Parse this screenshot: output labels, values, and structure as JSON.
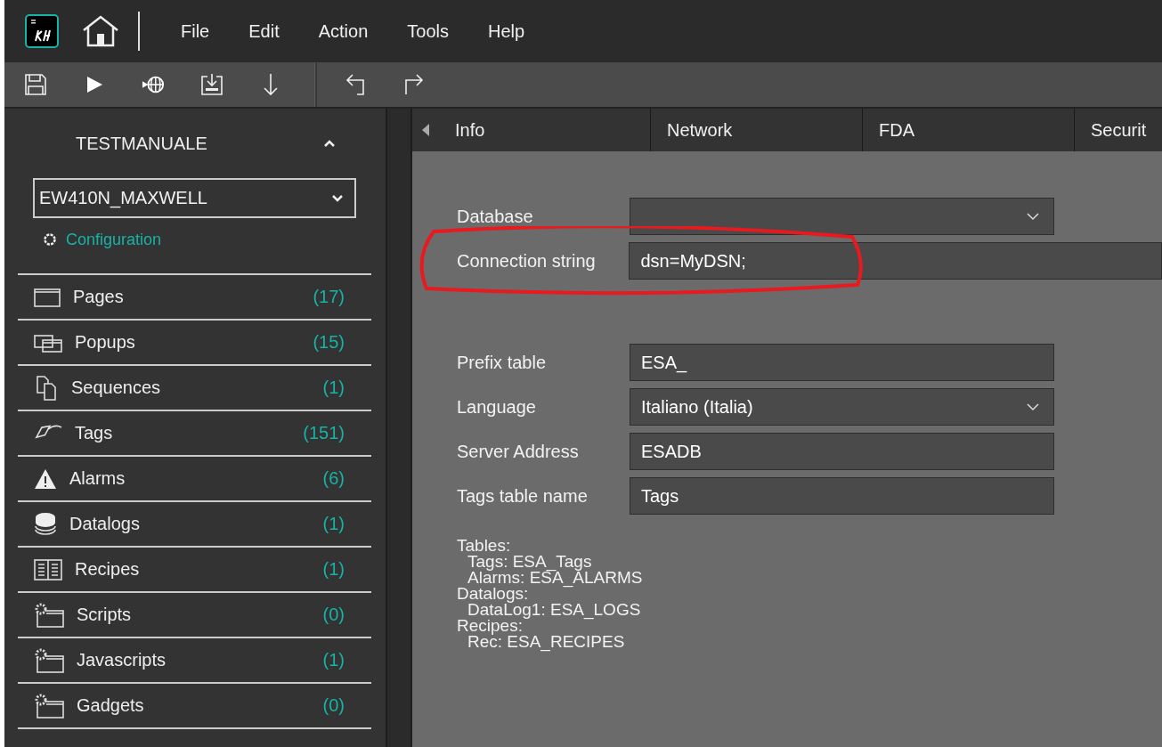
{
  "menu": [
    "File",
    "Edit",
    "Action",
    "Tools",
    "Help"
  ],
  "sidebar": {
    "project": "TESTMANUALE",
    "device": "EW410N_MAXWELL",
    "configuration_link": "Configuration",
    "items": [
      {
        "kind": "pages",
        "label": "Pages",
        "count": "(17)"
      },
      {
        "kind": "popups",
        "label": "Popups",
        "count": "(15)"
      },
      {
        "kind": "sequences",
        "label": "Sequences",
        "count": "(1)"
      },
      {
        "kind": "tags",
        "label": "Tags",
        "count": "(151)"
      },
      {
        "kind": "alarms",
        "label": "Alarms",
        "count": "(6)"
      },
      {
        "kind": "datalogs",
        "label": "Datalogs",
        "count": "(1)"
      },
      {
        "kind": "recipes",
        "label": "Recipes",
        "count": "(1)"
      },
      {
        "kind": "scripts",
        "label": "Scripts",
        "count": "(0)"
      },
      {
        "kind": "scripts",
        "label": "Javascripts",
        "count": "(1)"
      },
      {
        "kind": "scripts",
        "label": "Gadgets",
        "count": "(0)"
      }
    ]
  },
  "tabs": [
    "Info",
    "Network",
    "FDA",
    "Securit"
  ],
  "fields": [
    {
      "kind": "dropdown",
      "label": "Database"
    },
    {
      "kind": "wide",
      "label": "Connection string",
      "value": "dsn=MyDSN;",
      "highlighted": true
    },
    {
      "kind": "gap"
    },
    {
      "kind": "text",
      "label": "Prefix table",
      "value": "ESA_"
    },
    {
      "kind": "dropdown",
      "label": "Language",
      "value": "Italiano (Italia)"
    },
    {
      "kind": "text",
      "label": "Server Address",
      "value": "ESADB"
    },
    {
      "kind": "text",
      "label": "Tags table name",
      "value": "Tags"
    }
  ],
  "summary": [
    {
      "heading": "Tables:",
      "entries": [
        "Tags: ESA_Tags",
        "Alarms: ESA_ALARMS"
      ]
    },
    {
      "heading": "Datalogs:",
      "entries": [
        "DataLog1: ESA_LOGS"
      ]
    },
    {
      "heading": "Recipes:",
      "entries": [
        "Rec: ESA_RECIPES"
      ]
    }
  ]
}
